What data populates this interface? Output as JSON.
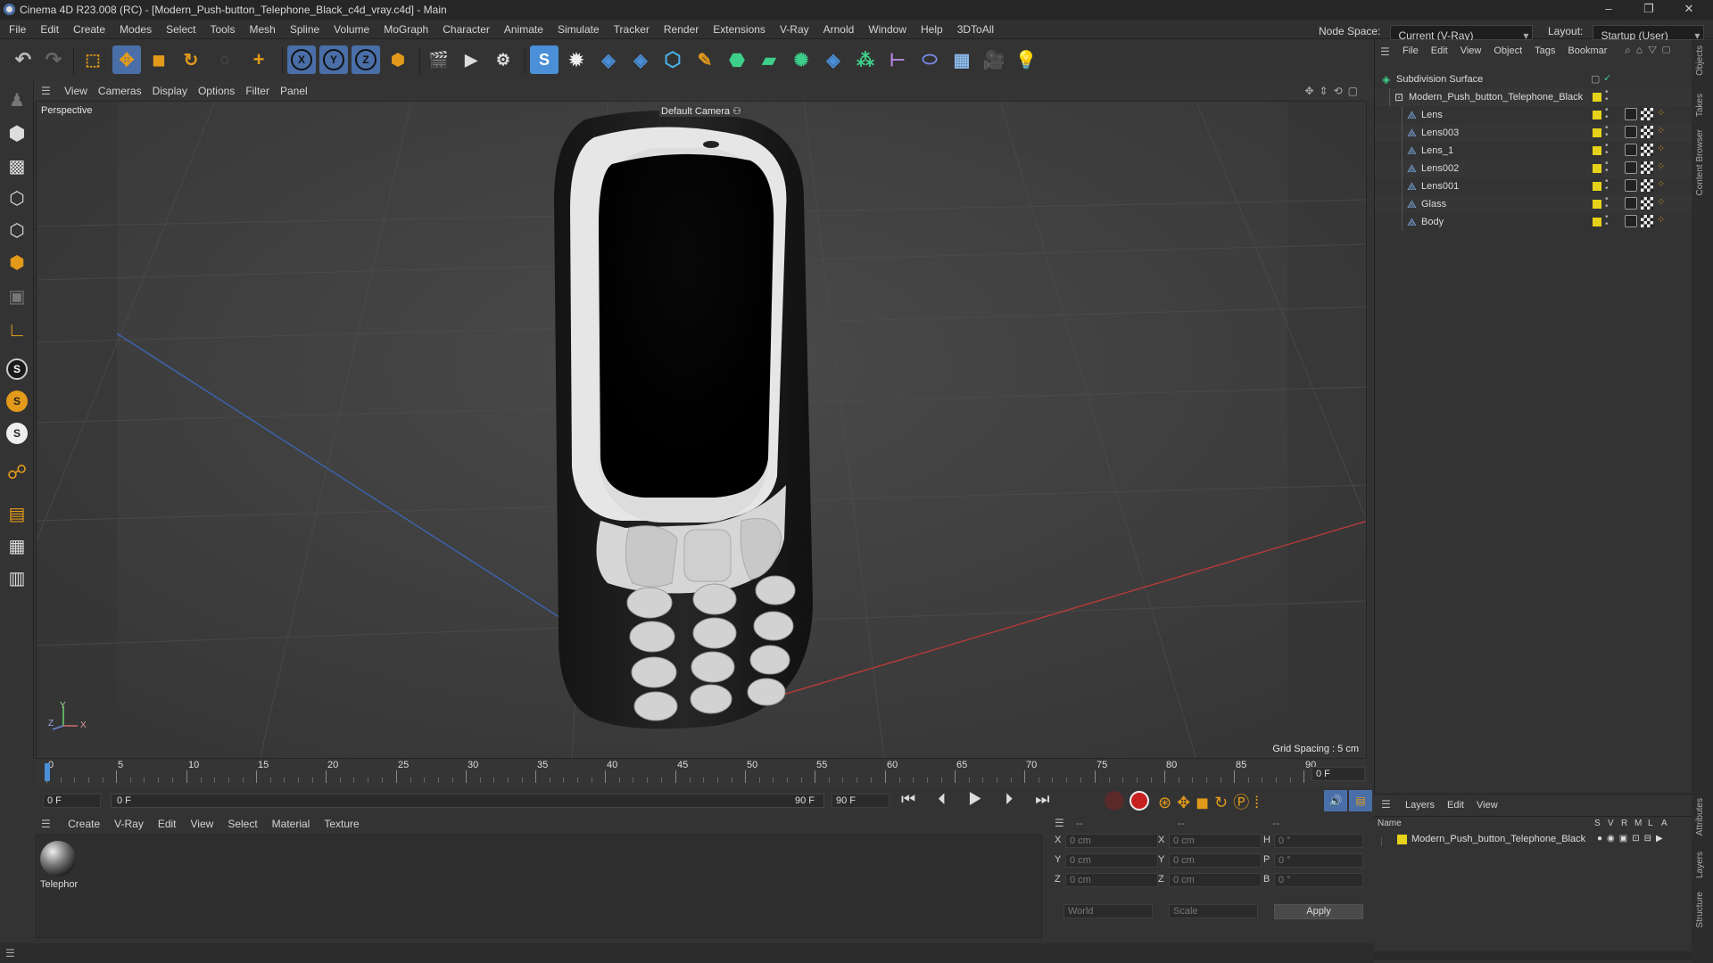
{
  "window": {
    "title": "Cinema 4D R23.008 (RC) - [Modern_Push-button_Telephone_Black_c4d_vray.c4d] - Main",
    "minimize": "–",
    "maximize": "❐",
    "close": "✕"
  },
  "menubar": {
    "items": [
      "File",
      "Edit",
      "Create",
      "Modes",
      "Select",
      "Tools",
      "Mesh",
      "Spline",
      "Volume",
      "MoGraph",
      "Character",
      "Animate",
      "Simulate",
      "Tracker",
      "Render",
      "Extensions",
      "V-Ray",
      "Arnold",
      "Window",
      "Help",
      "3DToAll"
    ],
    "node_space_label": "Node Space:",
    "node_space_value": "Current (V-Ray)",
    "layout_label": "Layout:",
    "layout_value": "Startup (User)"
  },
  "viewport": {
    "menu": [
      "View",
      "Cameras",
      "Display",
      "Options",
      "Filter",
      "Panel"
    ],
    "view_name": "Perspective",
    "camera": "Default Camera",
    "grid_spacing": "Grid Spacing : 5 cm",
    "axes": {
      "x": "X",
      "y": "Y",
      "z": "Z"
    }
  },
  "timeline": {
    "ticks": [
      "0",
      "5",
      "10",
      "15",
      "20",
      "25",
      "30",
      "35",
      "40",
      "45",
      "50",
      "55",
      "60",
      "65",
      "70",
      "75",
      "80",
      "85",
      "90"
    ],
    "current_frame": "0 F",
    "start_frame": "0 F",
    "range_start": "0 F",
    "range_end": "90 F",
    "end_frame": "90 F"
  },
  "materials": {
    "menu": [
      "Create",
      "V-Ray",
      "Edit",
      "View",
      "Select",
      "Material",
      "Texture"
    ],
    "items": [
      {
        "name": "Telephor"
      }
    ]
  },
  "coordinates": {
    "header_dash": "--",
    "rows": [
      {
        "a": "X",
        "av": "0 cm",
        "b": "X",
        "bv": "0 cm",
        "c": "H",
        "cv": "0 °"
      },
      {
        "a": "Y",
        "av": "0 cm",
        "b": "Y",
        "bv": "0 cm",
        "c": "P",
        "cv": "0 °"
      },
      {
        "a": "Z",
        "av": "0 cm",
        "b": "Z",
        "bv": "0 cm",
        "c": "B",
        "cv": "0 °"
      }
    ],
    "mode1": "World",
    "mode2": "Scale",
    "apply": "Apply"
  },
  "objects": {
    "menu": [
      "File",
      "Edit",
      "View",
      "Object",
      "Tags",
      "Bookmar"
    ],
    "tree": [
      {
        "name": "Subdivision Surface",
        "level": 0,
        "type": "subd"
      },
      {
        "name": "Modern_Push_button_Telephone_Black",
        "level": 1,
        "type": "null"
      },
      {
        "name": "Lens",
        "level": 2,
        "type": "poly"
      },
      {
        "name": "Lens003",
        "level": 2,
        "type": "poly"
      },
      {
        "name": "Lens_1",
        "level": 2,
        "type": "poly"
      },
      {
        "name": "Lens002",
        "level": 2,
        "type": "poly"
      },
      {
        "name": "Lens001",
        "level": 2,
        "type": "poly"
      },
      {
        "name": "Glass",
        "level": 2,
        "type": "poly"
      },
      {
        "name": "Body",
        "level": 2,
        "type": "poly"
      }
    ]
  },
  "layers": {
    "menu": [
      "Layers",
      "Edit",
      "View"
    ],
    "columns": {
      "name": "Name",
      "flags": [
        "S",
        "V",
        "R",
        "M",
        "L",
        "A"
      ]
    },
    "items": [
      {
        "name": "Modern_Push_button_Telephone_Black",
        "color": "#e6d21a"
      }
    ]
  },
  "right_tabs": [
    "Objects",
    "Takes",
    "Content Browser",
    "Attributes",
    "Layers",
    "Structure"
  ],
  "colors": {
    "accent": "#4a8fd8",
    "orange": "#e39a1b",
    "layer_yellow": "#e6d21a"
  }
}
